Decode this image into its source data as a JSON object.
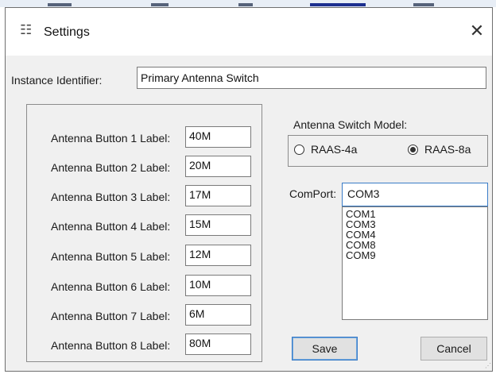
{
  "window": {
    "title": "Settings",
    "icon": "settings-app-icon",
    "close_glyph": "✕"
  },
  "instance": {
    "label": "Instance Identifier:",
    "value": "Primary Antenna Switch"
  },
  "antenna_buttons": [
    {
      "label": "Antenna Button 1 Label:",
      "value": "40M"
    },
    {
      "label": "Antenna Button 2 Label:",
      "value": "20M"
    },
    {
      "label": "Antenna Button 3 Label:",
      "value": "17M"
    },
    {
      "label": "Antenna Button 4 Label:",
      "value": "15M"
    },
    {
      "label": "Antenna Button 5 Label:",
      "value": "12M"
    },
    {
      "label": "Antenna Button 6 Label:",
      "value": "10M"
    },
    {
      "label": "Antenna Button 7 Label:",
      "value": "6M"
    },
    {
      "label": "Antenna Button 8 Label:",
      "value": "80M"
    }
  ],
  "model": {
    "label": "Antenna Switch Model:",
    "options": [
      {
        "label": "RAAS-4a",
        "selected": false
      },
      {
        "label": "RAAS-8a",
        "selected": true
      }
    ]
  },
  "comport": {
    "label": "ComPort:",
    "value": "COM3",
    "options": [
      "COM1",
      "COM3",
      "COM4",
      "COM8",
      "COM9"
    ]
  },
  "buttons": {
    "save": "Save",
    "cancel": "Cancel"
  },
  "colors": {
    "focus_blue": "#3a7cc7",
    "dialog_bg": "#f0f0f0"
  }
}
